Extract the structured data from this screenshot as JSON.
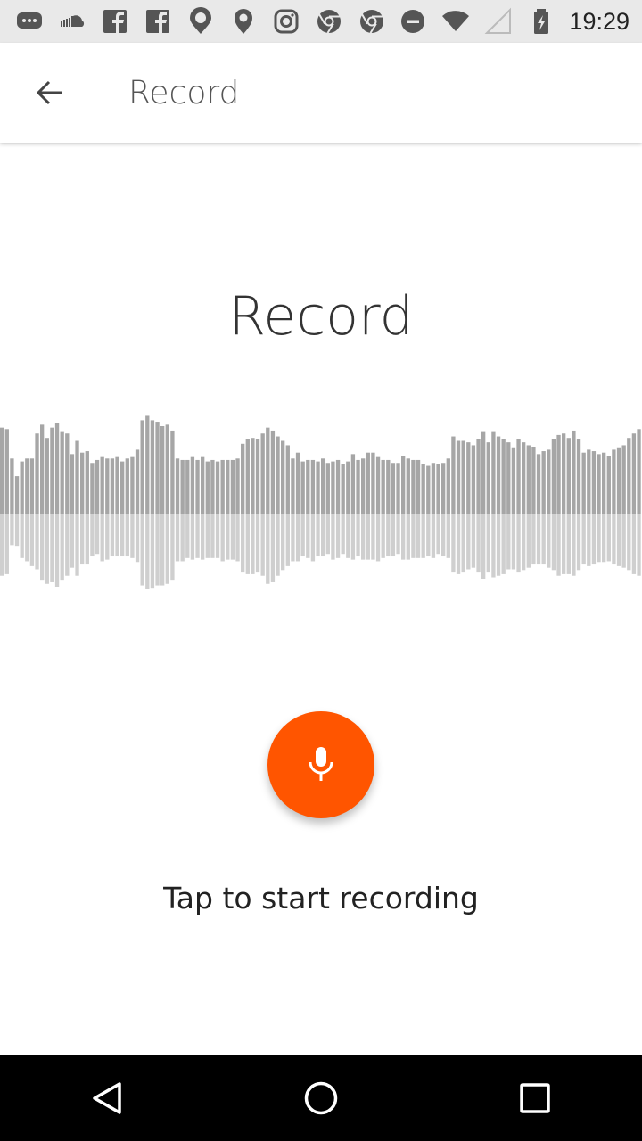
{
  "status_bar": {
    "time": "19:29",
    "left_icons": [
      "messages-icon",
      "soundcloud-icon",
      "facebook-icon",
      "facebook-icon",
      "maps-pin-icon",
      "maps-pin-icon",
      "instagram-icon",
      "chrome-icon",
      "chrome-icon"
    ],
    "right_icons": [
      "do-not-disturb-icon",
      "wifi-icon",
      "cell-signal-icon",
      "battery-charging-icon"
    ]
  },
  "app_bar": {
    "back_icon": "arrow-back-icon",
    "title": "Record"
  },
  "content": {
    "heading": "Record",
    "record_icon": "microphone-icon",
    "hint": "Tap to start recording"
  },
  "waveform": {
    "upper_levels": [
      0.59,
      0.58,
      0.38,
      0.26,
      0.36,
      0.38,
      0.38,
      0.55,
      0.61,
      0.52,
      0.59,
      0.62,
      0.56,
      0.55,
      0.41,
      0.5,
      0.42,
      0.43,
      0.35,
      0.37,
      0.39,
      0.38,
      0.38,
      0.39,
      0.36,
      0.38,
      0.39,
      0.44,
      0.64,
      0.67,
      0.64,
      0.63,
      0.6,
      0.61,
      0.57,
      0.38,
      0.37,
      0.37,
      0.39,
      0.37,
      0.39,
      0.36,
      0.37,
      0.36,
      0.37,
      0.37,
      0.37,
      0.38,
      0.48,
      0.51,
      0.52,
      0.51,
      0.55,
      0.59,
      0.57,
      0.53,
      0.5,
      0.47,
      0.38,
      0.42,
      0.36,
      0.37,
      0.37,
      0.36,
      0.38,
      0.35,
      0.36,
      0.37,
      0.34,
      0.36,
      0.41,
      0.37,
      0.38,
      0.42,
      0.42,
      0.39,
      0.37,
      0.37,
      0.35,
      0.35,
      0.4,
      0.38,
      0.37,
      0.37,
      0.34,
      0.33,
      0.35,
      0.34,
      0.35,
      0.38,
      0.53,
      0.5,
      0.5,
      0.49,
      0.47,
      0.51,
      0.56,
      0.49,
      0.56,
      0.53,
      0.51,
      0.49,
      0.45,
      0.51,
      0.49,
      0.47,
      0.46,
      0.41,
      0.43,
      0.44,
      0.51,
      0.54,
      0.55,
      0.52,
      0.57,
      0.51,
      0.42,
      0.44,
      0.43,
      0.41,
      0.42,
      0.4,
      0.44,
      0.45,
      0.47,
      0.52,
      0.55,
      0.58
    ],
    "lower_levels": [
      0.38,
      0.37,
      0.19,
      0.2,
      0.27,
      0.29,
      0.32,
      0.34,
      0.41,
      0.43,
      0.42,
      0.45,
      0.41,
      0.38,
      0.33,
      0.38,
      0.31,
      0.31,
      0.26,
      0.25,
      0.29,
      0.28,
      0.26,
      0.26,
      0.26,
      0.26,
      0.27,
      0.3,
      0.44,
      0.47,
      0.46,
      0.44,
      0.44,
      0.43,
      0.41,
      0.29,
      0.29,
      0.27,
      0.28,
      0.27,
      0.28,
      0.27,
      0.27,
      0.27,
      0.29,
      0.28,
      0.28,
      0.29,
      0.36,
      0.37,
      0.37,
      0.36,
      0.38,
      0.43,
      0.42,
      0.38,
      0.35,
      0.32,
      0.29,
      0.29,
      0.26,
      0.27,
      0.29,
      0.26,
      0.26,
      0.25,
      0.28,
      0.27,
      0.25,
      0.27,
      0.28,
      0.26,
      0.28,
      0.28,
      0.28,
      0.29,
      0.27,
      0.26,
      0.26,
      0.25,
      0.28,
      0.28,
      0.27,
      0.27,
      0.27,
      0.26,
      0.27,
      0.25,
      0.26,
      0.27,
      0.36,
      0.37,
      0.36,
      0.34,
      0.33,
      0.36,
      0.4,
      0.36,
      0.39,
      0.38,
      0.37,
      0.34,
      0.34,
      0.36,
      0.35,
      0.33,
      0.31,
      0.31,
      0.31,
      0.33,
      0.35,
      0.38,
      0.37,
      0.37,
      0.38,
      0.35,
      0.31,
      0.32,
      0.31,
      0.3,
      0.3,
      0.29,
      0.31,
      0.32,
      0.33,
      0.35,
      0.37,
      0.38
    ]
  },
  "colors": {
    "accent": "#ff5500",
    "wave_upper": "#a6a6a6",
    "wave_lower": "#cfcfcf"
  },
  "nav_bar": {
    "icons": [
      "back-triangle-icon",
      "home-circle-icon",
      "recents-square-icon"
    ]
  }
}
